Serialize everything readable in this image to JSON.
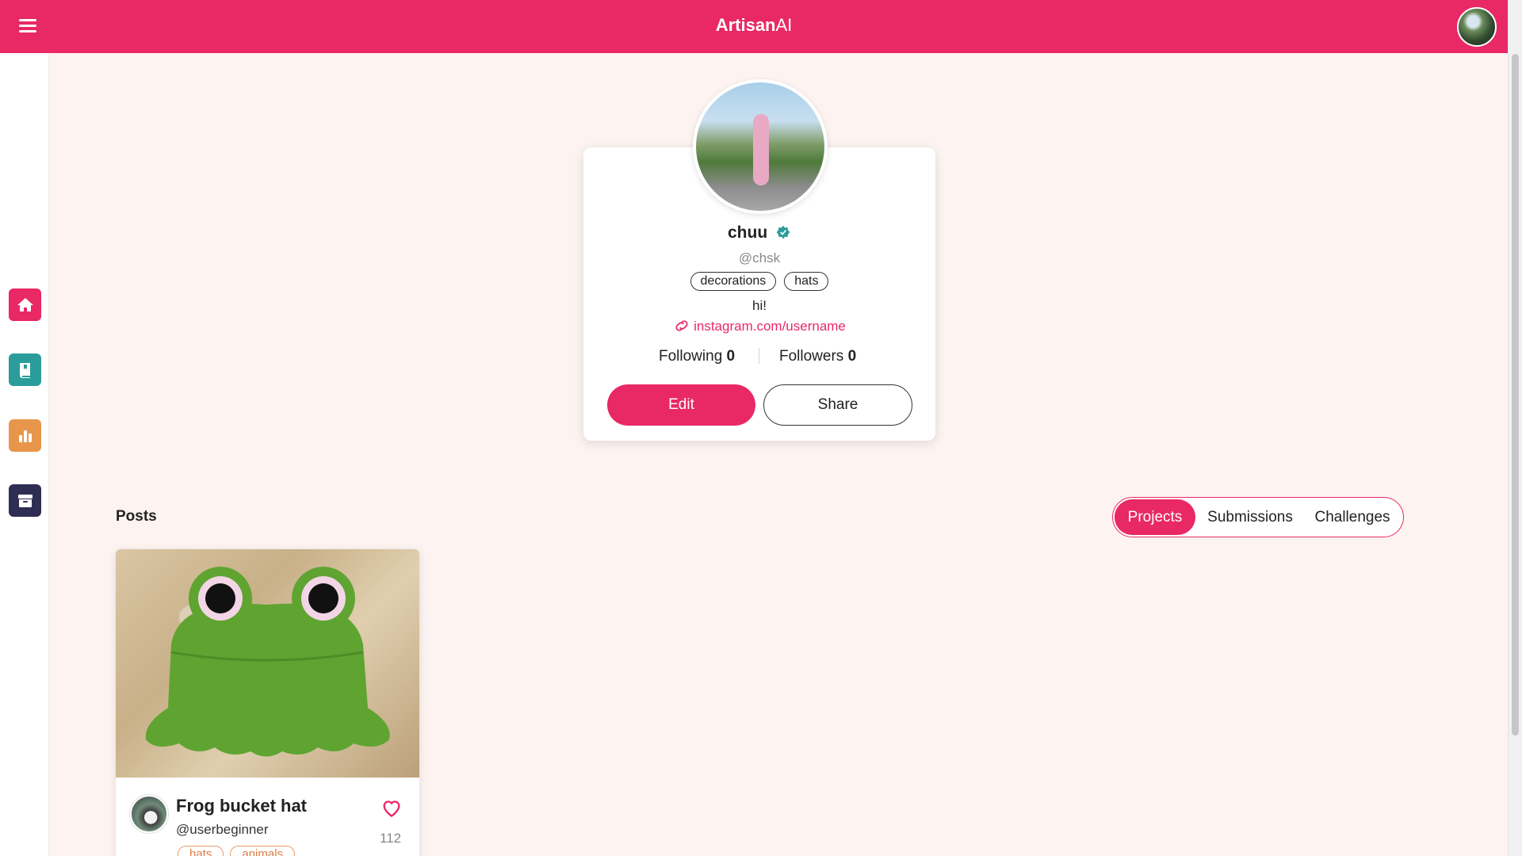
{
  "app": {
    "brand_bold": "Artisan",
    "brand_light": "AI"
  },
  "sidebar": {
    "items": [
      {
        "name": "home",
        "icon": "home-icon",
        "color": "#e92866"
      },
      {
        "name": "learn",
        "icon": "book-icon",
        "color": "#2a9d9b"
      },
      {
        "name": "stats",
        "icon": "bar-chart-icon",
        "color": "#e8964c"
      },
      {
        "name": "archive",
        "icon": "archive-icon",
        "color": "#2f2e52"
      }
    ]
  },
  "profile": {
    "name": "chuu",
    "handle": "@chsk",
    "tags": [
      "decorations",
      "hats"
    ],
    "bio": "hi!",
    "link": "instagram.com/username",
    "following_label": "Following",
    "following_count": "0",
    "followers_label": "Followers",
    "followers_count": "0",
    "edit_label": "Edit",
    "share_label": "Share"
  },
  "posts": {
    "title": "Posts",
    "tabs": [
      "Projects",
      "Submissions",
      "Challenges"
    ],
    "active_tab": "Projects",
    "items": [
      {
        "title": "Frog bucket hat",
        "user": "@userbeginner",
        "tags": [
          "hats",
          "animals"
        ],
        "likes": "112"
      }
    ]
  },
  "colors": {
    "accent": "#e92866",
    "background": "#fdf4f2",
    "verified": "#2a9d9b",
    "tag_orange": "#e07a42"
  }
}
